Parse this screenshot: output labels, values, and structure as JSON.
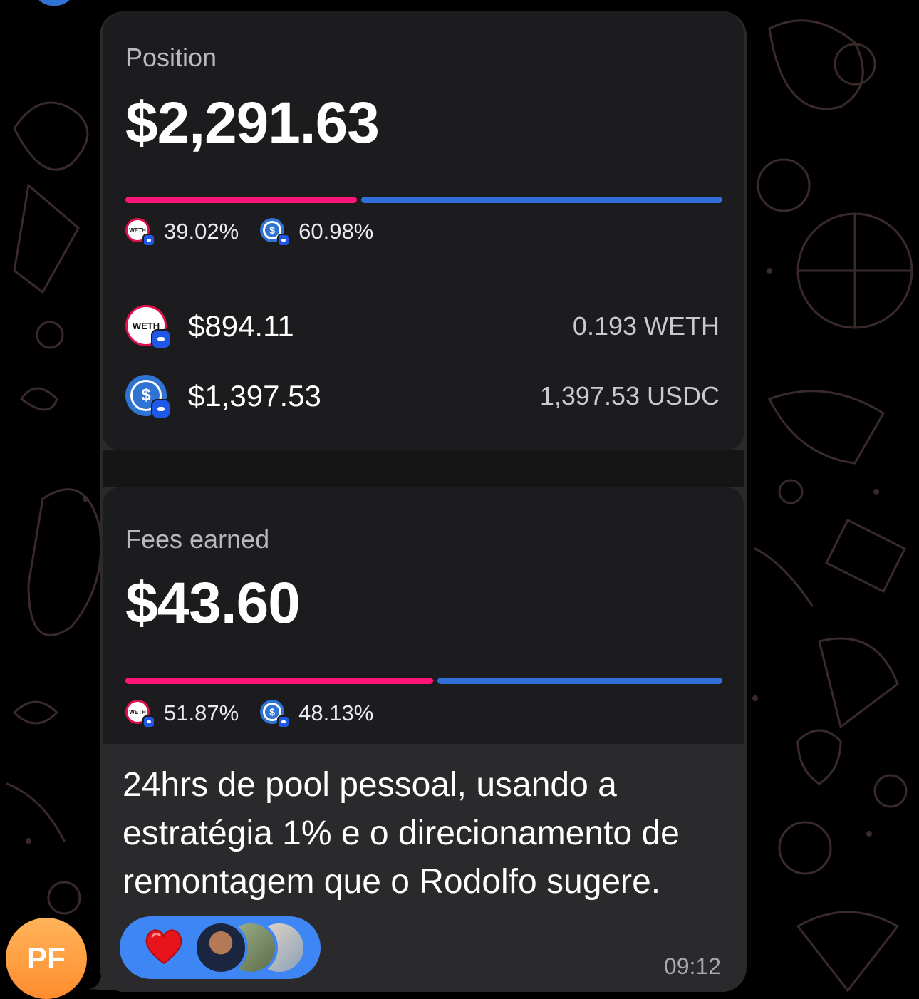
{
  "position": {
    "label": "Position",
    "total": "$2,291.63",
    "split": [
      {
        "token": "WETH",
        "icon": "weth-icon",
        "percent": "39.02%",
        "fraction": 0.3902
      },
      {
        "token": "USDC",
        "icon": "usdc-icon",
        "percent": "60.98%",
        "fraction": 0.6098
      }
    ],
    "assets": [
      {
        "token": "WETH",
        "icon": "weth-icon",
        "icon_text": "WETH",
        "usd": "$894.11",
        "amount": "0.193 WETH"
      },
      {
        "token": "USDC",
        "icon": "usdc-icon",
        "icon_text": "$",
        "usd": "$1,397.53",
        "amount": "1,397.53 USDC"
      }
    ]
  },
  "fees": {
    "label": "Fees earned",
    "total": "$43.60",
    "split": [
      {
        "token": "WETH",
        "icon": "weth-icon",
        "percent": "51.87%",
        "fraction": 0.5187
      },
      {
        "token": "USDC",
        "icon": "usdc-icon",
        "percent": "48.13%",
        "fraction": 0.4813
      }
    ]
  },
  "message": {
    "text": "24hrs de pool pessoal, usando a estratégia 1% e o direcionamento de remontagem que o Rodolfo sugere.",
    "time": "09:12",
    "reaction": "heart-icon",
    "reactor_count": 3
  },
  "sender": {
    "initials": "PF"
  },
  "colors": {
    "weth_bar": "#ff1478",
    "usdc_bar": "#2f6fd6",
    "reaction_pill": "#3f86f5",
    "avatar_orange": "#ff9a3c"
  }
}
